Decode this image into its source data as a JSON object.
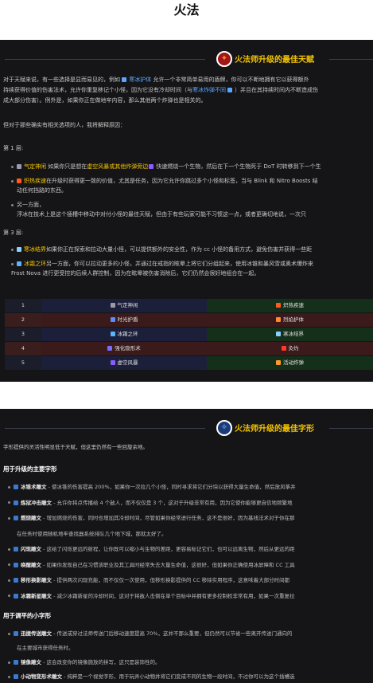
{
  "page_title": "火法",
  "talents_section": {
    "heading": "火法师升级的最佳天赋",
    "intro_line1": "对于天赋来说，有一些选择是显而易见的，例如",
    "intro_hl1": "寒冰护体",
    "intro_line1b": "允许一个非常简单易用的盾牌，你可以不断地拥有它以获得额外",
    "intro_line2a": "持续获得价值的伤害法术，允许你重复移记个小怪，因为它没有冷却时间（与",
    "intro_hl2": "寒冰炸弹不同",
    "intro_line2b": "）并且在其持续时间内不断造成伤",
    "intro_line3": "成大部分伤害）。例外是，如果你正在做地牢内容，那么其他两个炸弹也是相关的。",
    "reason_line": "但对于那些确实有相关选项的人，我将解释原因：",
    "tier1_label": "第 1 层:",
    "t1_b1_hl": "气定神闲",
    "t1_b1_text": "如果你只是想在",
    "t1_b1_hl2": "虚空风暴或其他炸弹旁边",
    "t1_b1_text2": "快速燃烧一个生物，然后在下一个生物死于 DoT 时转移到下一个生",
    "t1_b2_hl": "炽热疾速",
    "t1_b2_text": "在升级时获得更一致的价值，尤其是任务，因为它允许你跳过多个小怪和标签，当与 Blink 和 Nitro Boosts 结",
    "t1_b2_text2": "动任何挡路的东西。",
    "t1_b3_text": "另一方面，",
    "t1_b3_hl": "浮冰在技术上是这个插槽中移动中对付小怪的最佳天赋，但由于有些玩家可能不习惯这一点，或者更确切地说，一次只",
    "tier3_label": "第 3 层:",
    "t3_b1_hl": "寒冰结界",
    "t3_b1_text": "如果你正在探索和拉动大量小怪，可以提供额外的安全性，作为 cc 小怪的备用方式，避免伤害并获得一些距",
    "t3_b2_hl": "冰霜之环",
    "t3_b2_text": "另一方面，你可以拉动更多的小怪，并通过在戒指的眩晕上将它们分组起来，使用冰锥和暴风雪或奥术爆炸来",
    "t3_b2_text2": "Frost Nova 进行更受控的后续人群控制，因为在眩晕被伤害消除后，它们仍然会很好地组合在一起。",
    "table": [
      {
        "num": "1",
        "a": "气定神闲",
        "b": "炽热疾速",
        "a_bg": "#1c1f3a",
        "b_bg": "#15301a",
        "a_ic": "#9a9aa8",
        "b_ic": "#ff5a1f"
      },
      {
        "num": "2",
        "a": "时光护盾",
        "b": "烈焰护体",
        "a_bg": "#3a1a1a",
        "b_bg": "#3a1a1a",
        "a_ic": "#5a8cff",
        "b_ic": "#ff8a2a"
      },
      {
        "num": "3",
        "a": "冰霜之环",
        "b": "寒冰结界",
        "a_bg": "#1c1f3a",
        "b_bg": "#15301a",
        "a_ic": "#5ab4ff",
        "b_ic": "#8ad0ff"
      },
      {
        "num": "4",
        "a": "强化隐形术",
        "b": "灸灼",
        "a_bg": "#3a1a1a",
        "b_bg": "#3a1a1a",
        "a_ic": "#7a6cff",
        "b_ic": "#ff3a2a"
      },
      {
        "num": "5",
        "a": "虚空风暴",
        "b": "活动炸弹",
        "a_bg": "#1c1f3a",
        "b_bg": "#15301a",
        "a_ic": "#8a5cff",
        "b_ic": "#ff9a2a"
      }
    ],
    "num_colors": [
      "#1b1d2a",
      "#3a1e1e",
      "#1b1d2a",
      "#3a1e1e",
      "#1b1d2a"
    ]
  },
  "glyphs_section": {
    "heading": "火法师升级的最佳字形",
    "intro": "字形提供的灵活性明显低于天赋，但这里仍然有一些回旋余地。",
    "major_head": "用于升级的主要字形",
    "major": [
      {
        "name": "冰锥术雕文",
        "text": " - 使冰锥的伤害提高 200%，如果你一次拉几个小怪，同时寻求将它们分块以获得大量生命值，然后放风筝并"
      },
      {
        "name": "炼狱冲击雕文",
        "text": " - 允许你将点传播给 4 个敌人，而不仅仅是 3 个，这对于升级非常有用，因为它使你能够更自信地频繁地"
      },
      {
        "name": "燃烧雕文",
        "text": " - 增加燃烧的伤害，同时也增加其冷却时间，尽管如果你经常进行任务，这不是很好，因为基线法术对于你在那"
      },
      {
        "name": "",
        "text": "在任务时使用随机地牢查找器系统排队几个地下城，那就太好了。"
      },
      {
        "name": "闪现雕文",
        "text": " - 这给了闪烁更远的射程，让你既可以缩小与生物的差距，更容易标记它们，也可以远离生物，然后从更远的距"
      },
      {
        "name": "唤醒雕文",
        "text": " - 如果你发现自己在习惯该职业及其工具时经常失去大量生命值，这很好，但如果你正确使用冰屏障和 CC 工具"
      },
      {
        "name": "移形换影雕文",
        "text": " - 提供两次闪现充能，而不仅仅一次使用，但移形换影提供的 CC 移除实用程序，这意味着大部分时间都"
      },
      {
        "name": "冰霜新星雕文",
        "text": " - 减少冰霜新星的冷却时间，这对于将敌人击倒在单个目标中并拥有更多控制权非常有用，如果一次重复拉"
      }
    ],
    "minor_head": "用于调平的小字形",
    "minor": [
      {
        "name": "迅捷传送雕文",
        "text": " - 传送或穿过法师传送门后移动速度提高 70%，这并不那么重要，但仍然可以节省一些离开传送门通向的"
      },
      {
        "name": "",
        "text": "在主要城市获得任务时。"
      },
      {
        "name": "镜像雕文",
        "text": " - 这会改变你的镜像施放的拼写，这只是装饰性的。"
      },
      {
        "name": "小动物变形术雕文",
        "text": " - 纯粹是一个视觉字形，用于玩弄小动物并将它们变成不同的生物一段时间，不过你可以为这个插槽选"
      }
    ]
  },
  "colors": {
    "panel_bg": "#151517",
    "accent_yellow": "#f5c400",
    "accent_blue": "#5aa7ff",
    "accent_red": "#ff4040"
  }
}
